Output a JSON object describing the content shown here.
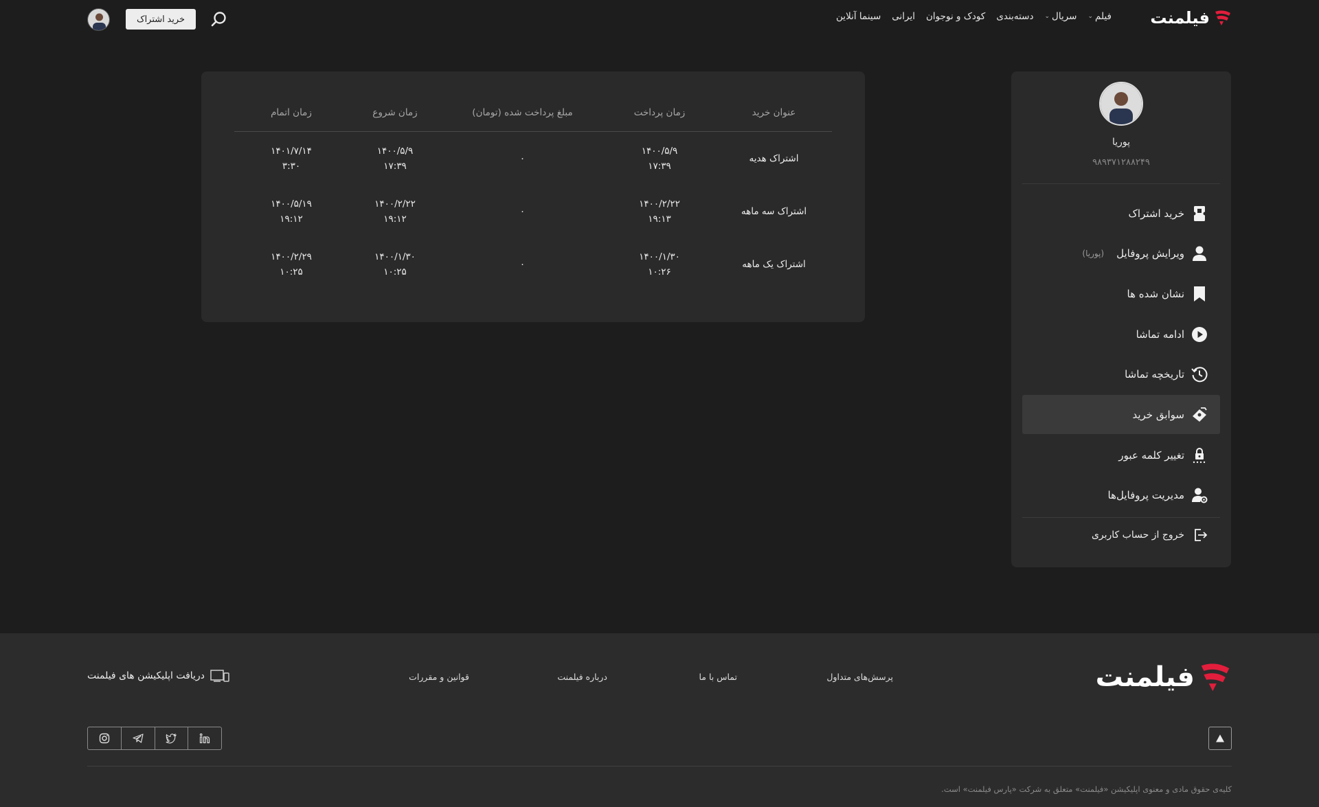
{
  "brand": {
    "logo_text": "فیلمنت",
    "accent_color": "#e21e3c"
  },
  "header": {
    "nav": [
      {
        "label": "فیلم",
        "dropdown": true
      },
      {
        "label": "سریال",
        "dropdown": true
      },
      {
        "label": "دسته‌بندی",
        "dropdown": false
      },
      {
        "label": "کودک و نوجوان",
        "dropdown": false
      },
      {
        "label": "ایرانی",
        "dropdown": false
      },
      {
        "label": "سینما آنلاین",
        "dropdown": false
      }
    ],
    "buy_label": "خرید اشتراک",
    "search_icon": "search-icon"
  },
  "profile": {
    "name": "پوریا",
    "phone": "۹۸۹۳۷۱۲۸۸۲۴۹",
    "menu": [
      {
        "label": "خرید اشتراک",
        "icon": "ticket-icon",
        "active": false
      },
      {
        "label": "ویرایش پروفایل",
        "sub": "(پوریا)",
        "icon": "user-icon",
        "active": false
      },
      {
        "label": "نشان شده ها",
        "icon": "bookmark-icon",
        "active": false
      },
      {
        "label": "ادامه تماشا",
        "icon": "play-icon",
        "active": false
      },
      {
        "label": "تاریخچه تماشا",
        "icon": "history-icon",
        "active": false
      },
      {
        "label": "سوابق خرید",
        "icon": "purchase-icon",
        "active": true
      },
      {
        "label": "تغییر کلمه عبور",
        "icon": "lock-icon",
        "active": false
      },
      {
        "label": "مدیریت پروفایل‌ها",
        "icon": "manage-profiles-icon",
        "active": false
      }
    ],
    "logout_label": "خروج از حساب کاربری"
  },
  "purchases": {
    "columns": [
      "عنوان خرید",
      "زمان پرداخت",
      "مبلغ پرداخت شده (تومان)",
      "زمان شروع",
      "زمان اتمام"
    ],
    "rows": [
      {
        "title": "اشتراک هدیه",
        "paid_date": "۱۴۰۰/۵/۹",
        "paid_time": "۱۷:۳۹",
        "amount": "۰",
        "start_date": "۱۴۰۰/۵/۹",
        "start_time": "۱۷:۳۹",
        "end_date": "۱۴۰۱/۷/۱۴",
        "end_time": "۳:۳۰"
      },
      {
        "title": "اشتراک سه ماهه",
        "paid_date": "۱۴۰۰/۲/۲۲",
        "paid_time": "۱۹:۱۳",
        "amount": "۰",
        "start_date": "۱۴۰۰/۲/۲۲",
        "start_time": "۱۹:۱۲",
        "end_date": "۱۴۰۰/۵/۱۹",
        "end_time": "۱۹:۱۲"
      },
      {
        "title": "اشتراک یک ماهه",
        "paid_date": "۱۴۰۰/۱/۳۰",
        "paid_time": "۱۰:۲۶",
        "amount": "۰",
        "start_date": "۱۴۰۰/۱/۳۰",
        "start_time": "۱۰:۲۵",
        "end_date": "۱۴۰۰/۲/۲۹",
        "end_time": "۱۰:۲۵"
      }
    ]
  },
  "footer": {
    "links": [
      "پرسش‌های متداول",
      "تماس با ما",
      "درباره فیلمنت",
      "قوانین و مقررات"
    ],
    "apps_label": "دریافت اپلیکیشن های فیلمنت",
    "socials": [
      "linkedin-icon",
      "twitter-icon",
      "telegram-icon",
      "instagram-icon"
    ],
    "copyright": "کلیه‌ی حقوق مادی و معنوی اپلیکیشن «فیلمنت» متعلق به شرکت «پارس فیلمنت» است."
  }
}
